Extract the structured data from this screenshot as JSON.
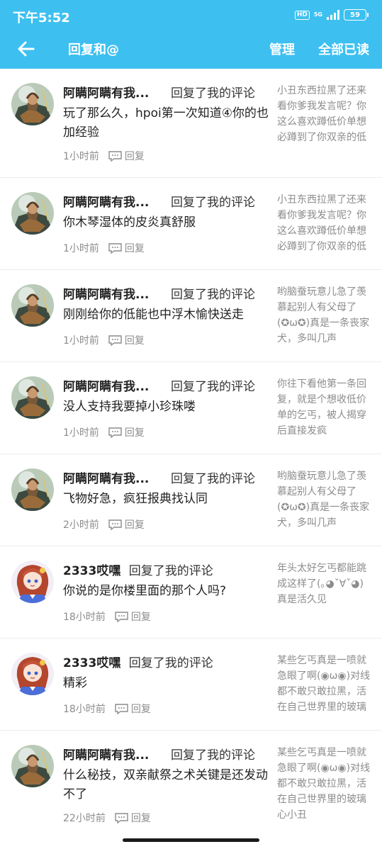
{
  "status_bar": {
    "time": "下午5:52",
    "hd": "HD",
    "network": "5G",
    "battery": "59"
  },
  "header": {
    "title": "回复和@",
    "manage": "管理",
    "mark_all_read": "全部已读"
  },
  "reply_label": "回复",
  "items": [
    {
      "user": "阿瞒阿瞒有我...",
      "action": "回复了我的评论",
      "message": "玩了那么久，hpoi第一次知道④你的也加经验",
      "time": "1小时前",
      "quote": "小丑东西拉黑了还来看你爹我发言呢？你这么喜欢蹲低价单想必蹲到了你双亲的低价骨...",
      "avatar": "warrior-avatar"
    },
    {
      "user": "阿瞒阿瞒有我...",
      "action": "回复了我的评论",
      "message": "你木琴湿体的皮炎真舒服",
      "time": "1小时前",
      "quote": "小丑东西拉黑了还来看你爹我发言呢？你这么喜欢蹲低价单想必蹲到了你双亲的低价骨",
      "avatar": "warrior-avatar"
    },
    {
      "user": "阿瞒阿瞒有我...",
      "action": "回复了我的评论",
      "message": "刚刚给你的低能也中浮木愉快送走",
      "time": "1小时前",
      "quote": "哟脑蚕玩意儿急了羡慕起别人有父母了(✪ω✪)真是一条丧家犬，多叫几声",
      "avatar": "warrior-avatar"
    },
    {
      "user": "阿瞒阿瞒有我...",
      "action": "回复了我的评论",
      "message": "没人支持我要掉小珍珠喽",
      "time": "1小时前",
      "quote": "你往下看他第一条回复，就是个想收低价单的乞丐，被人揭穿后直接发疯",
      "avatar": "warrior-avatar"
    },
    {
      "user": "阿瞒阿瞒有我...",
      "action": "回复了我的评论",
      "message": "飞物好急，疯狂报典找认同",
      "time": "2小时前",
      "quote": "哟脑蚕玩意儿急了羡慕起别人有父母了(✪ω✪)真是一条丧家犬，多叫几声",
      "avatar": "warrior-avatar"
    },
    {
      "user": "2333哎嘿",
      "action": "回复了我的评论",
      "message": "你说的是你楼里面的那个人吗?",
      "time": "18小时前",
      "quote": "年头太好乞丐都能跳成这样了(｡◕ˇ∀ˇ◕)真是活久见",
      "avatar": "anime-avatar"
    },
    {
      "user": "2333哎嘿",
      "action": "回复了我的评论",
      "message": "精彩",
      "time": "18小时前",
      "quote": "某些乞丐真是一喷就急眼了啊(◉ω◉)对线都不敢只敢拉黑，活在自己世界里的玻璃心小丑",
      "avatar": "anime-avatar"
    },
    {
      "user": "阿瞒阿瞒有我...",
      "action": "回复了我的评论",
      "message": "什么秘技，双亲献祭之术关键是还发动不了",
      "time": "22小时前",
      "quote": "某些乞丐真是一喷就急眼了啊(◉ω◉)对线都不敢只敢拉黑，活在自己世界里的玻璃心小丑",
      "avatar": "warrior-avatar"
    }
  ]
}
